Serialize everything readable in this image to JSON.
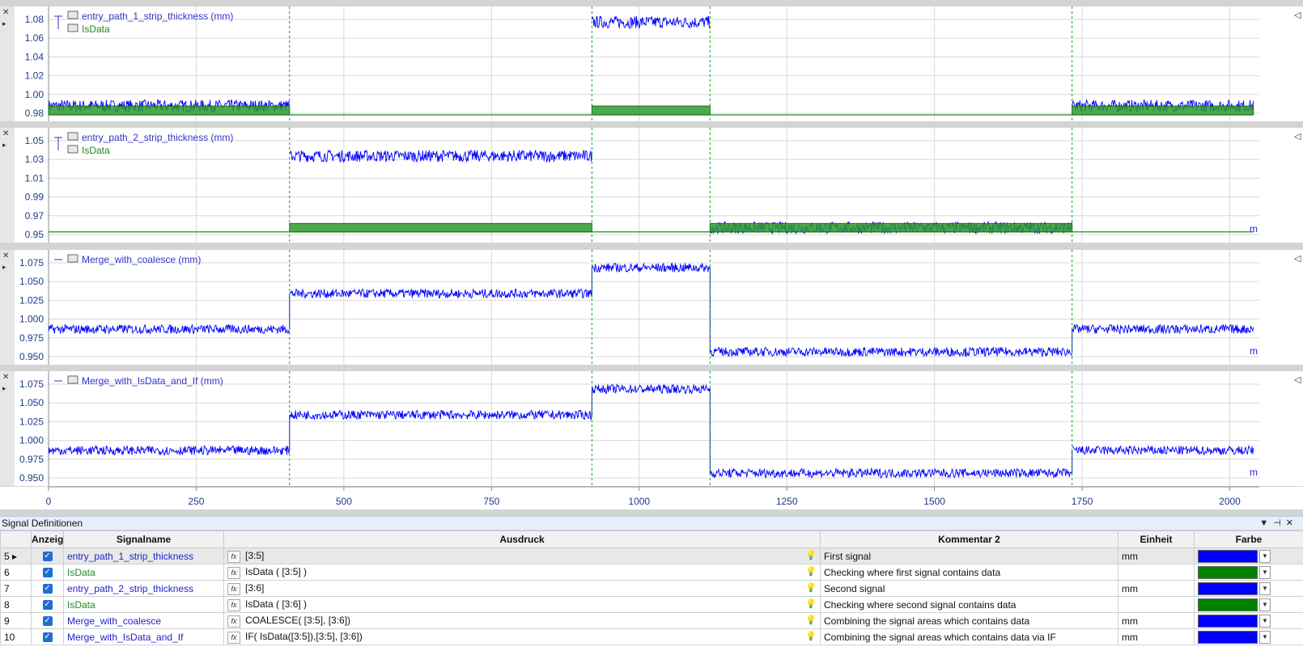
{
  "charts": {
    "panels": [
      {
        "legend": [
          {
            "label": "entry_path_1_strip_thickness (mm)",
            "color": "#3333cc"
          },
          {
            "label": "IsData",
            "color": "#1f8a1f"
          }
        ],
        "yticks": [
          "1.08",
          "1.06",
          "1.04",
          "1.02",
          "1.00",
          "0.98"
        ],
        "unit_label": ""
      },
      {
        "legend": [
          {
            "label": "entry_path_2_strip_thickness (mm)",
            "color": "#3333cc"
          },
          {
            "label": "IsData",
            "color": "#1f8a1f"
          }
        ],
        "yticks": [
          "1.05",
          "1.03",
          "1.01",
          "0.99",
          "0.97",
          "0.95"
        ],
        "unit_label": "m"
      },
      {
        "legend": [
          {
            "label": "Merge_with_coalesce (mm)",
            "color": "#3333cc"
          }
        ],
        "yticks": [
          "1.075",
          "1.050",
          "1.025",
          "1.000",
          "0.975",
          "0.950"
        ],
        "unit_label": "m"
      },
      {
        "legend": [
          {
            "label": "Merge_with_IsData_and_If (mm)",
            "color": "#3333cc"
          }
        ],
        "yticks": [
          "1.075",
          "1.050",
          "1.025",
          "1.000",
          "0.975",
          "0.950"
        ],
        "unit_label": "m"
      }
    ],
    "xticks": [
      "0",
      "250",
      "500",
      "750",
      "1000",
      "1250",
      "1500",
      "1750",
      "2000"
    ]
  },
  "chart_data": [
    {
      "type": "line",
      "xlim": [
        0,
        2050
      ],
      "ylim": [
        0.98,
        1.09
      ],
      "markers_x": [
        408,
        920,
        1120,
        1733
      ],
      "series": [
        {
          "name": "entry_path_1_strip_thickness (mm)",
          "color": "#0000ff",
          "segments": [
            {
              "x": [
                0,
                408
              ],
              "mean": 0.99,
              "amp": 0.007
            },
            {
              "x": [
                920,
                1120
              ],
              "mean": 1.085,
              "amp": 0.007
            },
            {
              "x": [
                1733,
                2040
              ],
              "mean": 0.99,
              "amp": 0.007
            }
          ]
        },
        {
          "name": "IsData",
          "color": "#1f8a1f",
          "segments": [
            {
              "x": [
                0,
                408
              ],
              "low": 0.98,
              "high": 0.99
            },
            {
              "x": [
                920,
                1120
              ],
              "low": 0.98,
              "high": 0.99
            },
            {
              "x": [
                1733,
                2040
              ],
              "low": 0.98,
              "high": 0.99
            }
          ],
          "baseline": 0.98
        }
      ]
    },
    {
      "type": "line",
      "xlim": [
        0,
        2050
      ],
      "ylim": [
        0.945,
        1.06
      ],
      "markers_x": [
        408,
        920,
        1120,
        1733
      ],
      "series": [
        {
          "name": "entry_path_2_strip_thickness (mm)",
          "color": "#0000ff",
          "segments": [
            {
              "x": [
                408,
                920
              ],
              "mean": 1.04,
              "amp": 0.007
            },
            {
              "x": [
                1120,
                1733
              ],
              "mean": 0.955,
              "amp": 0.007
            }
          ]
        },
        {
          "name": "IsData",
          "color": "#1f8a1f",
          "segments": [
            {
              "x": [
                408,
                920
              ],
              "low": 0.95,
              "high": 0.96
            },
            {
              "x": [
                1120,
                1733
              ],
              "low": 0.95,
              "high": 0.96
            }
          ],
          "baseline": 0.95
        }
      ]
    },
    {
      "type": "line",
      "xlim": [
        0,
        2050
      ],
      "ylim": [
        0.945,
        1.095
      ],
      "markers_x": [
        408,
        920,
        1120,
        1733
      ],
      "series": [
        {
          "name": "Merge_with_coalesce (mm)",
          "color": "#0000ff",
          "segments": [
            {
              "x": [
                0,
                408
              ],
              "mean": 0.99,
              "amp": 0.007
            },
            {
              "x": [
                408,
                920
              ],
              "mean": 1.045,
              "amp": 0.007
            },
            {
              "x": [
                920,
                1120
              ],
              "mean": 1.085,
              "amp": 0.007
            },
            {
              "x": [
                1120,
                1733
              ],
              "mean": 0.955,
              "amp": 0.007
            },
            {
              "x": [
                1733,
                2040
              ],
              "mean": 0.99,
              "amp": 0.007
            }
          ]
        }
      ]
    },
    {
      "type": "line",
      "xlim": [
        0,
        2050
      ],
      "ylim": [
        0.945,
        1.095
      ],
      "markers_x": [
        408,
        920,
        1120,
        1733
      ],
      "series": [
        {
          "name": "Merge_with_IsData_and_If (mm)",
          "color": "#0000ff",
          "segments": [
            {
              "x": [
                0,
                408
              ],
              "mean": 0.99,
              "amp": 0.007
            },
            {
              "x": [
                408,
                920
              ],
              "mean": 1.045,
              "amp": 0.007
            },
            {
              "x": [
                920,
                1120
              ],
              "mean": 1.085,
              "amp": 0.007
            },
            {
              "x": [
                1120,
                1733
              ],
              "mean": 0.955,
              "amp": 0.007
            },
            {
              "x": [
                1733,
                2040
              ],
              "mean": 0.99,
              "amp": 0.007
            }
          ]
        }
      ]
    }
  ],
  "bottom_panel": {
    "title": "Signal Definitionen",
    "columns": [
      "Anzeige",
      "Signalname",
      "Ausdruck",
      "Kommentar 2",
      "Einheit",
      "Farbe"
    ],
    "rows": [
      {
        "num": "5",
        "name": "entry_path_1_strip_thickness",
        "name_color": "#2222cc",
        "expr": "[3:5]",
        "comment": "First signal",
        "unit": "mm",
        "color": "#0000ff",
        "selected": true
      },
      {
        "num": "6",
        "name": "IsData",
        "name_color": "#1f8a1f",
        "expr": "IsData ( [3:5] )",
        "comment": "Checking where first signal contains data",
        "unit": "",
        "color": "#008000",
        "selected": false
      },
      {
        "num": "7",
        "name": "entry_path_2_strip_thickness",
        "name_color": "#2222cc",
        "expr": "[3:6]",
        "comment": "Second signal",
        "unit": "mm",
        "color": "#0000ff",
        "selected": false
      },
      {
        "num": "8",
        "name": "IsData",
        "name_color": "#1f8a1f",
        "expr": "IsData ( [3:6] )",
        "comment": "Checking where second signal contains data",
        "unit": "",
        "color": "#008000",
        "selected": false
      },
      {
        "num": "9",
        "name": "Merge_with_coalesce",
        "name_color": "#2222cc",
        "expr": "COALESCE( [3:5], [3:6])",
        "comment": "Combining the signal areas which contains data",
        "unit": "mm",
        "color": "#0000ff",
        "selected": false
      },
      {
        "num": "10",
        "name": "Merge_with_IsData_and_If",
        "name_color": "#2222cc",
        "expr": "IF( IsData([3:5]),[3:5], [3:6])",
        "comment": "Combining the signal areas which contains data via IF",
        "unit": "mm",
        "color": "#0000ff",
        "selected": false
      }
    ]
  }
}
